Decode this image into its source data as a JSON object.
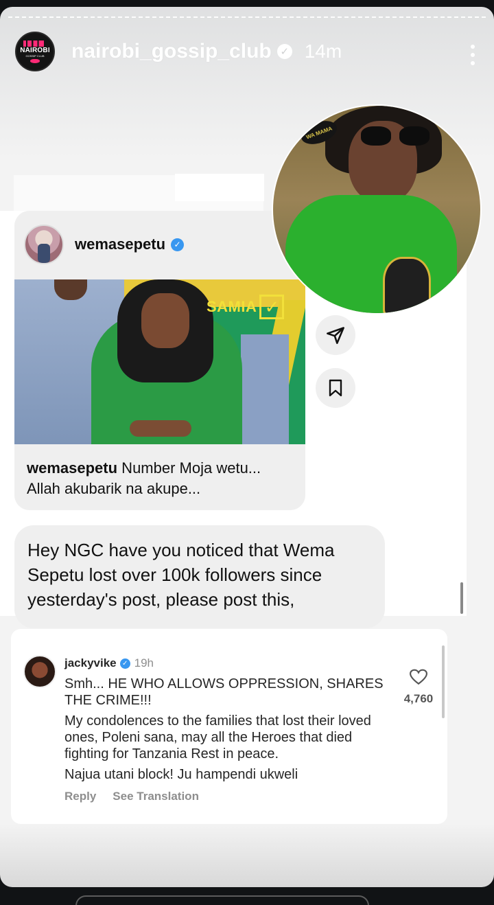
{
  "story": {
    "username": "nairobi_gossip_club",
    "time": "14m",
    "avatar_brand": "NAIROBI",
    "avatar_sub": "GOSSIP CLUB"
  },
  "post": {
    "username": "wemasepetu",
    "image_badge": "SAMIA",
    "caption_user": "wemasepetu",
    "caption_text": " Number Moja wetu... Allah akubarik na akupe..."
  },
  "profile_logo": "WA MAMA",
  "message": {
    "text": "Hey NGC have you noticed that Wema Sepetu lost over 100k followers since yesterday's post, please post this,"
  },
  "comment": {
    "username": "jackyvike",
    "time": "19h",
    "lines": [
      "Smh... HE WHO ALLOWS OPPRESSION, SHARES THE CRIME!!!",
      "My condolences  to the families that lost their loved ones, Poleni sana, may all the Heroes that died fighting for Tanzania Rest in peace.",
      "Najua utani block! Ju hampendi ukweli"
    ],
    "like_count": "4,760",
    "reply_label": "Reply",
    "translate_label": "See Translation"
  },
  "colors": {
    "verified_blue": "#3897f0",
    "brand_pink": "#ff2b77"
  }
}
